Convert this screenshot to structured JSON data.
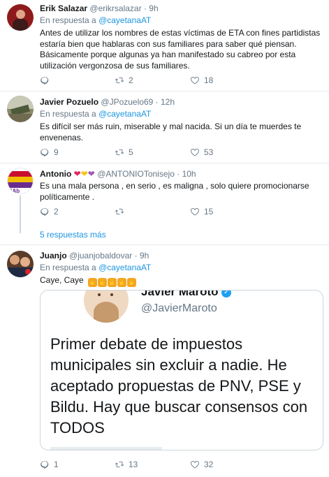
{
  "tweets": [
    {
      "name": "Erik Salazar",
      "handle": "@erikrsalazar",
      "time": "9h",
      "reply_prefix": "En respuesta a",
      "reply_to": "@cayetanaAT",
      "text": "Antes de utilizar los nombres de estas víctimas de ETA con fines partidistas estaría bien que hablaras con sus familiares para saber qué piensan. Básicamente porque algunas ya han manifestado su cabreo por esta utilización vergonzosa de sus familiares.",
      "replies": "",
      "retweets": "2",
      "likes": "18"
    },
    {
      "name": "Javier Pozuelo",
      "handle": "@JPozuelo69",
      "time": "12h",
      "reply_prefix": "En respuesta a",
      "reply_to": "@cayetanaAT",
      "text": "Es difícil ser más ruin, miserable y mal nacida. Si un día te muerdes te envenenas.",
      "replies": "9",
      "retweets": "5",
      "likes": "53"
    },
    {
      "name": "Antonio",
      "handle": "@ANTONIOTonisejo",
      "time": "10h",
      "text": "Es una mala persona , en serio , es maligna , solo quiere promocionarse políticamente .",
      "replies": "2",
      "retweets": "",
      "likes": "15"
    },
    {
      "name": "Juanjo",
      "handle": "@juanjobaldovar",
      "time": "9h",
      "reply_prefix": "En respuesta a",
      "reply_to": "@cayetanaAT",
      "text": "Caye, Caye",
      "replies": "1",
      "retweets": "13",
      "likes": "32"
    }
  ],
  "more_replies": "5 respuestas más",
  "embed": {
    "name": "Javier Maroto",
    "handle": "@JavierMaroto",
    "text": "Primer debate de impuestos municipales sin excluir a nadie. He aceptado propuestas de PNV, PSE y Bildu. Hay que buscar consensos con TODOS"
  },
  "icons": {
    "reply": "reply-icon",
    "retweet": "retweet-icon",
    "like": "heart-icon",
    "verified": "verified-badge-icon"
  },
  "colors": {
    "link": "#1b95e0",
    "muted": "#657786",
    "verified": "#1da1f2"
  }
}
